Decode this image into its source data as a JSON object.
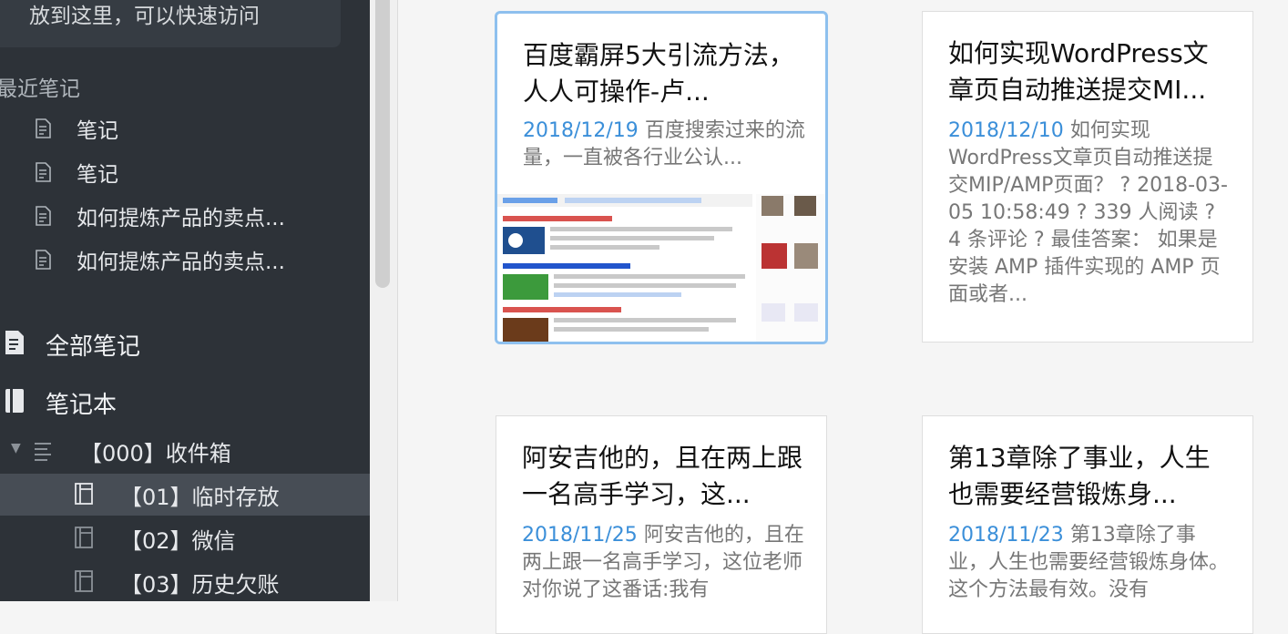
{
  "sidebar": {
    "shortcut_hint": "放到这里，可以快速访问",
    "recent_header": "最近笔记",
    "recent": [
      "笔记",
      "笔记",
      "如何提炼产品的卖点...",
      "如何提炼产品的卖点..."
    ],
    "all_notes": "全部笔记",
    "notebooks": "笔记本",
    "inbox": "【000】收件箱",
    "children": [
      "【01】临时存放",
      "【02】微信",
      "【03】历史欠账"
    ]
  },
  "cards": [
    {
      "title": "百度霸屏5大引流方法，人人可操作-卢...",
      "date": "2018/12/19",
      "snippet": "百度搜索过来的流量，一直被各行业公认..."
    },
    {
      "title": "如何实现WordPress文章页自动推送提交MI...",
      "date": "2018/12/10",
      "snippet": "如何实现WordPress文章页自动推送提交MIP/AMP页面？ ? 2018-03-05 10:58:49 ? 339 人阅读 ? 4 条评论 ? 最佳答案： 如果是安装 AMP 插件实现的 AMP 页面或者..."
    },
    {
      "title": "阿安吉他的，且在两上跟一名高手学习，这...",
      "date": "2018/11/25",
      "snippet": "阿安吉他的，且在两上跟一名高手学习，这位老师对你说了这番话:我有"
    },
    {
      "title": "第13章除了事业，人生也需要经营锻炼身...",
      "date": "2018/11/23",
      "snippet": "第13章除了事业，人生也需要经营锻炼身体。这个方法最有效。没有"
    }
  ],
  "colors": {
    "sidebar": "#2d3238",
    "accent": "#3b8fd9",
    "selection_border": "#8ec0ee"
  }
}
